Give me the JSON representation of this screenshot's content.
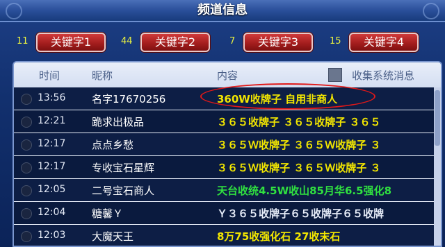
{
  "window": {
    "title": "频道信息"
  },
  "keywords": [
    {
      "count": "11",
      "label": "关键字1"
    },
    {
      "count": "44",
      "label": "关键字2"
    },
    {
      "count": "7",
      "label": "关键字3"
    },
    {
      "count": "15",
      "label": "关键字4"
    }
  ],
  "table": {
    "headers": {
      "time": "时间",
      "nick": "昵称",
      "content": "内容",
      "collect": "收集系统消息"
    },
    "rows": [
      {
        "time": "13:56",
        "nick": "名字17670256",
        "content": "360W收牌子 自用非商人",
        "color": "#f2e600"
      },
      {
        "time": "12:21",
        "nick": "跪求出极品",
        "content": "３６５收牌子 ３６５收牌子 ３６５",
        "color": "#f2e600"
      },
      {
        "time": "12:17",
        "nick": "点点乡愁",
        "content": "３６５Ｗ收牌子 ３６５Ｗ收牌子 ３",
        "color": "#f2e600"
      },
      {
        "time": "12:17",
        "nick": "专收宝石星辉",
        "content": "３６５Ｗ收牌子 ３６５Ｗ收牌子 ３",
        "color": "#f2e600"
      },
      {
        "time": "12:05",
        "nick": "二号宝石商人",
        "content": "天台收统4.5W收山85月华6.5强化8",
        "color": "#30e040"
      },
      {
        "time": "12:04",
        "nick": "糖馨Ｙ",
        "content": "Ｙ３６５收牌子６５收牌子６５收牌",
        "color": "#e6ecf8"
      },
      {
        "time": "12:03",
        "nick": "大魔天王",
        "content": "8万75收强化石 27收末石",
        "color": "#f2e600"
      }
    ]
  }
}
